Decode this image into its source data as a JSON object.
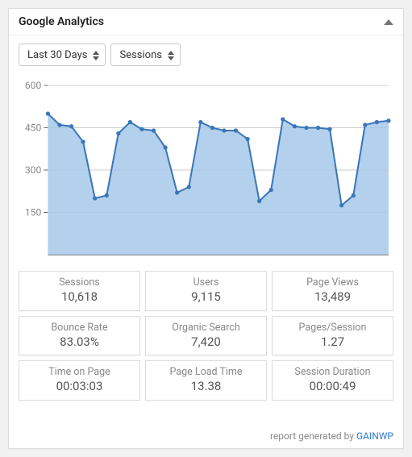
{
  "header": {
    "title": "Google Analytics"
  },
  "selects": {
    "range": "Last 30 Days",
    "metric": "Sessions"
  },
  "stats": [
    {
      "label": "Sessions",
      "value": "10,618"
    },
    {
      "label": "Users",
      "value": "9,115"
    },
    {
      "label": "Page Views",
      "value": "13,489"
    },
    {
      "label": "Bounce Rate",
      "value": "83.03%"
    },
    {
      "label": "Organic Search",
      "value": "7,420"
    },
    {
      "label": "Pages/Session",
      "value": "1.27"
    },
    {
      "label": "Time on Page",
      "value": "00:03:03"
    },
    {
      "label": "Page Load Time",
      "value": "13.38"
    },
    {
      "label": "Session Duration",
      "value": "00:00:49"
    }
  ],
  "footer": {
    "text": "report generated by ",
    "link_label": "GAINWP"
  },
  "chart_data": {
    "type": "line",
    "title": "",
    "xlabel": "",
    "ylabel": "",
    "ylim": [
      0,
      600
    ],
    "yticks": [
      150,
      300,
      450,
      600
    ],
    "x": [
      1,
      2,
      3,
      4,
      5,
      6,
      7,
      8,
      9,
      10,
      11,
      12,
      13,
      14,
      15,
      16,
      17,
      18,
      19,
      20,
      21,
      22,
      23,
      24,
      25,
      26,
      27,
      28,
      29,
      30
    ],
    "series": [
      {
        "name": "Sessions",
        "values": [
          500,
          460,
          455,
          400,
          200,
          210,
          430,
          470,
          445,
          440,
          380,
          220,
          240,
          470,
          450,
          440,
          440,
          410,
          190,
          230,
          480,
          455,
          450,
          450,
          445,
          175,
          210,
          460,
          470,
          475
        ]
      }
    ],
    "colors": {
      "line": "#3a76b8",
      "fill": "#a6c8e9"
    }
  }
}
